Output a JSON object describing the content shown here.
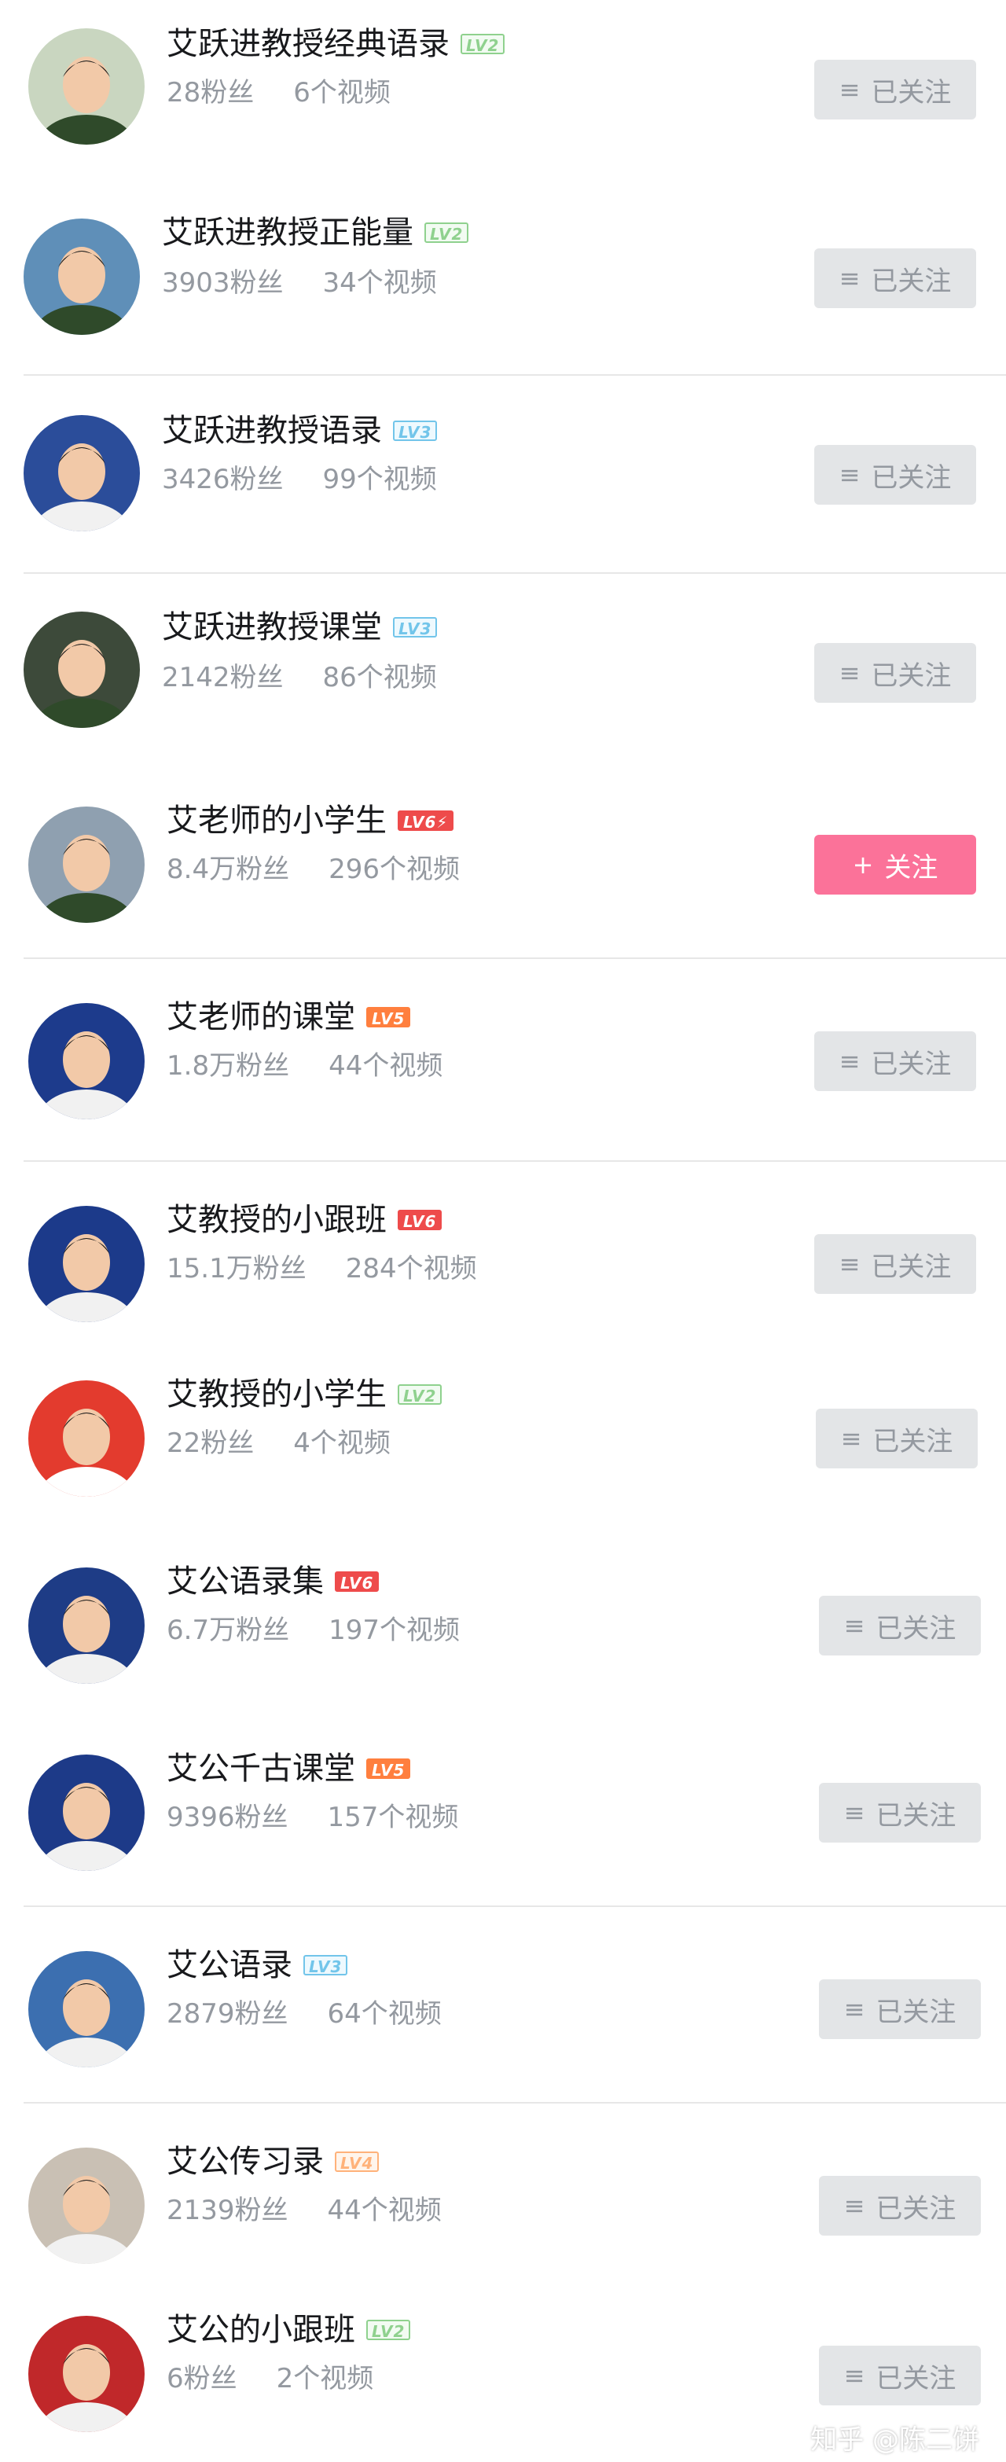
{
  "items": [
    {
      "name": "艾跃进教授经典语录",
      "level": "LV2",
      "fans": "28粉丝",
      "videos": "6个视频",
      "follow_label": "已关注",
      "followed": true
    },
    {
      "name": "艾跃进教授正能量",
      "level": "LV2",
      "fans": "3903粉丝",
      "videos": "34个视频",
      "follow_label": "已关注",
      "followed": true
    },
    {
      "name": "艾跃进教授语录",
      "level": "LV3",
      "fans": "3426粉丝",
      "videos": "99个视频",
      "follow_label": "已关注",
      "followed": true
    },
    {
      "name": "艾跃进教授课堂",
      "level": "LV3",
      "fans": "2142粉丝",
      "videos": "86个视频",
      "follow_label": "已关注",
      "followed": true
    },
    {
      "name": "艾老师的小学生",
      "level": "LV6⚡",
      "fans": "8.4万粉丝",
      "videos": "296个视频",
      "follow_label": "关注",
      "followed": false
    },
    {
      "name": "艾老师的课堂",
      "level": "LV5",
      "fans": "1.8万粉丝",
      "videos": "44个视频",
      "follow_label": "已关注",
      "followed": true
    },
    {
      "name": "艾教授的小跟班",
      "level": "LV6",
      "fans": "15.1万粉丝",
      "videos": "284个视频",
      "follow_label": "已关注",
      "followed": true
    },
    {
      "name": "艾教授的小学生",
      "level": "LV2",
      "fans": "22粉丝",
      "videos": "4个视频",
      "follow_label": "已关注",
      "followed": true
    },
    {
      "name": "艾公语录集",
      "level": "LV6",
      "fans": "6.7万粉丝",
      "videos": "197个视频",
      "follow_label": "已关注",
      "followed": true
    },
    {
      "name": "艾公千古课堂",
      "level": "LV5",
      "fans": "9396粉丝",
      "videos": "157个视频",
      "follow_label": "已关注",
      "followed": true
    },
    {
      "name": "艾公语录",
      "level": "LV3",
      "fans": "2879粉丝",
      "videos": "64个视频",
      "follow_label": "已关注",
      "followed": true
    },
    {
      "name": "艾公传习录",
      "level": "LV4",
      "fans": "2139粉丝",
      "videos": "44个视频",
      "follow_label": "已关注",
      "followed": true
    },
    {
      "name": "艾公的小跟班",
      "level": "LV2",
      "fans": "6粉丝",
      "videos": "2个视频",
      "follow_label": "已关注",
      "followed": true
    }
  ],
  "watermark": "知乎 @陈二饼",
  "colors": {
    "follow_button": "#fb7299",
    "followed_button": "#e3e5e7",
    "meta_text": "#9499a0"
  }
}
